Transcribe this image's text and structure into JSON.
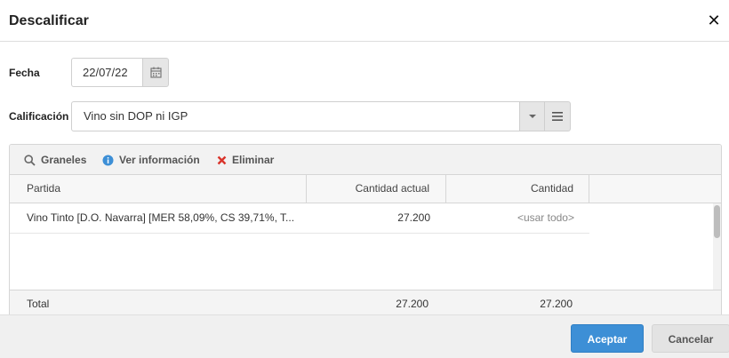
{
  "dialog": {
    "title": "Descalificar",
    "close_glyph": "✕"
  },
  "fields": {
    "date_label": "Fecha",
    "date_value": "22/07/22",
    "qualification_label": "Calificación",
    "qualification_value": "Vino sin DOP ni IGP"
  },
  "toolbar": {
    "items": [
      {
        "label": "Graneles",
        "icon": "search-icon"
      },
      {
        "label": "Ver información",
        "icon": "info-icon"
      },
      {
        "label": "Eliminar",
        "icon": "delete-x-icon"
      }
    ]
  },
  "grid": {
    "columns": [
      "Partida",
      "Cantidad actual",
      "Cantidad"
    ],
    "rows": [
      {
        "partida": "Vino Tinto [D.O. Navarra] [MER 58,09%, CS 39,71%, T...",
        "cantidad_actual": "27.200",
        "cantidad": "<usar todo>"
      }
    ],
    "footer": {
      "label": "Total",
      "cantidad_actual": "27.200",
      "cantidad": "27.200"
    }
  },
  "buttons": {
    "accept": "Aceptar",
    "cancel": "Cancelar"
  },
  "colors": {
    "primary": "#3d8fd6",
    "delete": "#d9342b",
    "info": "#3d8fd6"
  }
}
